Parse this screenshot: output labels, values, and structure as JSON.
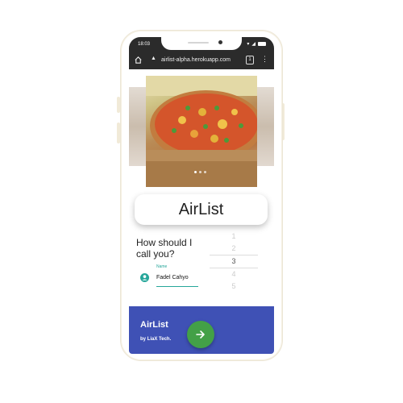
{
  "status_bar": {
    "time": "18:03"
  },
  "browser": {
    "url": "airlist-alpha.herokuapp.com",
    "tab_count": "1"
  },
  "carousel": {
    "slides": 3,
    "active": 0
  },
  "app_title": "AirList",
  "question": "How should I call you?",
  "name_field": {
    "label": "Name",
    "value": "Fadel Cahyo"
  },
  "picker": {
    "options": [
      "1",
      "2",
      "3",
      "4",
      "5"
    ],
    "selected": "3"
  },
  "footer": {
    "brand": "AirList",
    "byline": "by LiaX Tech."
  },
  "colors": {
    "primary": "#3f51b5",
    "fab": "#43a047",
    "accent": "#26a69a"
  },
  "icons": {
    "home": "home-icon",
    "warning": "warning-icon",
    "menu": "more-vert-icon",
    "person": "account-circle-icon",
    "next": "arrow-right-icon"
  }
}
